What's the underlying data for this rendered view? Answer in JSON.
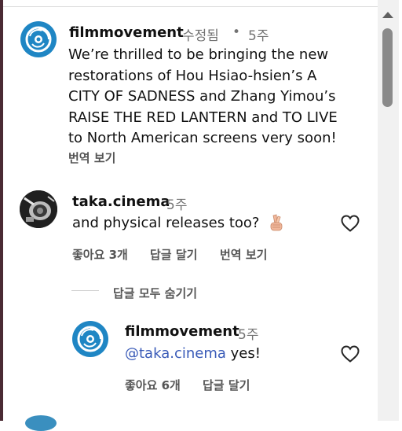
{
  "comments": [
    {
      "username": "filmmovement",
      "edited": "수정됨",
      "separator": "•",
      "time": "5주",
      "lines": [
        "We’re thrilled to be bringing the new",
        "restorations of Hou Hsiao-hsien’s A",
        "CITY OF SADNESS and Zhang Yimou’s",
        "RAISE THE RED LANTERN and TO LIVE",
        "to North American screens very soon!"
      ],
      "translate": "번역 보기"
    },
    {
      "username": "taka.cinema",
      "time": "5주",
      "text": "and physical releases too?",
      "emoji": "fingers-crossed-emoji",
      "likes": "좋아요 3개",
      "reply": "답글 달기",
      "translate": "번역 보기"
    }
  ],
  "hide_replies": "답글 모두 숨기기",
  "reply": {
    "username": "filmmovement",
    "time": "5주",
    "mention": "@taka.cinema",
    "text": " yes!",
    "likes": "좋아요 6개",
    "reply": "답글 달기"
  },
  "icons": {
    "heart": "heart-outline-icon",
    "scroll_up": "scroll-up-arrow-icon"
  },
  "colors": {
    "text": "#111111",
    "meta": "#737373",
    "mention": "#3a5bb8",
    "brand": "#1f86c4"
  }
}
